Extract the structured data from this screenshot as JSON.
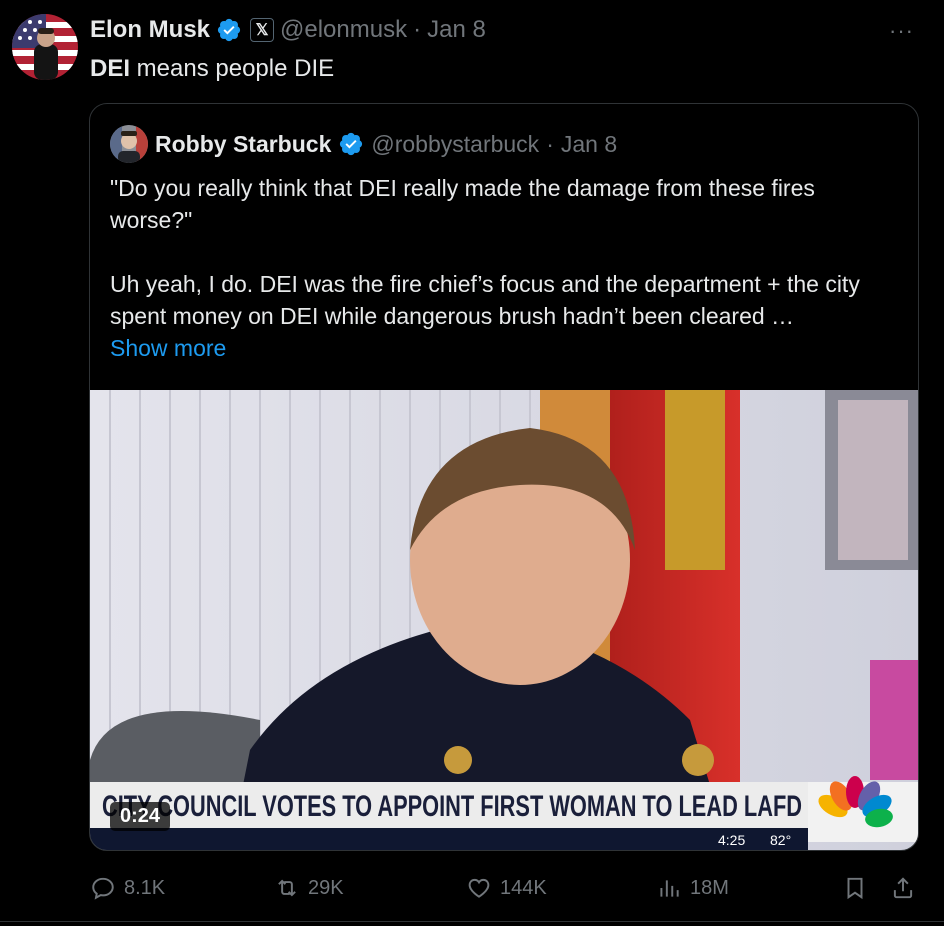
{
  "tweet": {
    "author_name": "Elon Musk",
    "author_handle": "@elonmusk",
    "separator": "·",
    "date": "Jan 8",
    "affiliate_badge": "𝕏",
    "text_bold": "DEI",
    "text_rest": " means people DIE",
    "more_label": "···"
  },
  "quote": {
    "author_name": "Robby Starbuck",
    "author_handle": "@robbystarbuck",
    "separator": "·",
    "date": "Jan 8",
    "paragraph1": "\"Do you really think that DEI really made the damage from these fires worse?\"",
    "paragraph2": "Uh yeah, I do. DEI was the fire chief’s focus and the department + the city spent money on DEI while dangerous brush hadn’t been cleared …",
    "show_more": "Show more",
    "video": {
      "duration": "0:24",
      "chyron": "CITY COUNCIL VOTES TO APPOINT FIRST WOMAN TO LEAD LAFD",
      "clock": "4:25",
      "temperature": "82°"
    }
  },
  "actions": {
    "replies": "8.1K",
    "reposts": "29K",
    "likes": "144K",
    "views": "18M"
  },
  "colors": {
    "background": "#000000",
    "text": "#e7e9ea",
    "muted": "#71767b",
    "accent": "#1d9bf0",
    "border": "#2f3336"
  }
}
